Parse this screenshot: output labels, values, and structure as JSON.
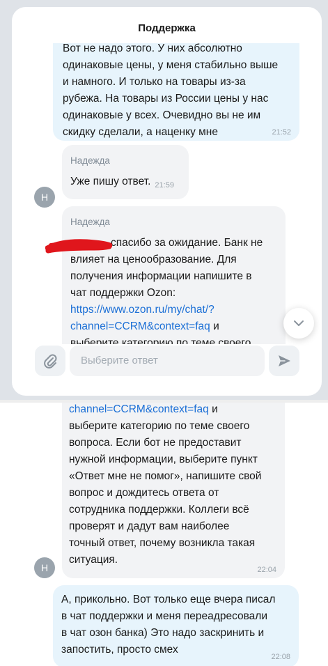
{
  "header": {
    "title": "Поддержка"
  },
  "messages": {
    "m1": {
      "lines": [
        "Вот не надо этого. У них абсолютно",
        "одинаковые цены, у меня стабильно выше",
        "и намного. И только на товары из-за",
        "рубежа. На товары из России цены у нас",
        "одинаковые у всех. Очевидно вы не им",
        "скидку сделали, а наценку мне"
      ],
      "time": "21:52"
    },
    "m2": {
      "sender": "Надежда",
      "avatar": "Н",
      "text": "Уже пишу ответ.",
      "time": "21:59"
    },
    "m3": {
      "sender": "Надежда",
      "lines": [
        "спасибо за ожидание. Банк не",
        "влияет на ценообразование. Для",
        "получения информации напишите в",
        "чат поддержки Ozon:"
      ],
      "link1": "https://www.ozon.ru/my/chat/?",
      "link2": "channel=CCRM&context=faq",
      "link_tail": " и",
      "cut_line": "выберите категорию по теме своего"
    },
    "m3_continued": {
      "link": "channel=CCRM&context=faq",
      "link_tail": " и",
      "lines": [
        "выберите категорию по теме своего",
        "вопроса. Если бот не предоставит",
        "нужной информации, выберите пункт",
        "«Ответ мне не помог», напишите свой",
        "вопрос и дождитесь ответа от",
        "сотрудника поддержки. Коллеги всё",
        "проверят и дадут вам наиболее",
        "точный ответ, почему возникла такая",
        "ситуация."
      ],
      "avatar": "Н",
      "time": "22:04"
    },
    "m4": {
      "lines": [
        "А, прикольно. Вот только еще вчера писал",
        "в чат поддержки и меня переадресовали",
        "в чат озон банка) Это надо заскринить и",
        "запостить, просто смех"
      ],
      "time": "22:08"
    }
  },
  "composer": {
    "placeholder": "Выберите ответ"
  },
  "icons": {
    "attach": "paperclip-icon",
    "send": "send-arrow-icon",
    "scroll": "chevron-down-icon",
    "redaction": "red-scribble"
  },
  "colors": {
    "outgoing_bubble": "#e7f4fc",
    "incoming_bubble": "#f2f3f5",
    "link": "#1b6fd6",
    "redaction": "#e0161c"
  }
}
